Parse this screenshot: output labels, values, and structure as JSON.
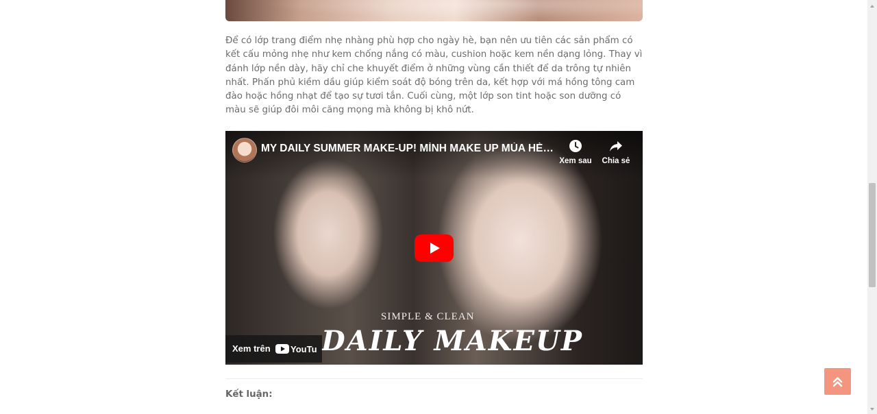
{
  "article": {
    "paragraph": "Để có lớp trang điểm nhẹ nhàng phù hợp cho ngày hè, bạn nên ưu tiên các sản phẩm có kết cấu mỏng nhẹ như kem chống nắng có màu, cushion hoặc kem nền dạng lỏng. Thay vì đánh lớp nền dày, hãy chỉ che khuyết điểm ở những vùng cần thiết để da trông tự nhiên nhất. Phấn phủ kiềm dầu giúp kiểm soát độ bóng trên da, kết hợp với má hồng tông cam đào hoặc hồng nhạt để tạo sự tươi tắn. Cuối cùng, một lớp son tint hoặc son dưỡng có màu sẽ giúp đôi môi căng mọng mà không bị khô nứt.",
    "conclusion_heading": "Kết luận:"
  },
  "video": {
    "title": "MY DAILY SUMMER MAKE-UP! MÌNH MAKE UP MÙA HÈ NHƯ ...",
    "watch_later_label": "Xem sau",
    "share_label": "Chia sẻ",
    "watch_on_label": "Xem trên",
    "youtube_logo_text": "YouTube",
    "overlay_small": "SIMPLE & CLEAN",
    "overlay_big": "DAILY MAKEUP",
    "play_icon": "youtube-play-icon"
  },
  "colors": {
    "back_to_top_bg": "#f4967f",
    "play_red": "#ff0000",
    "text_gray": "#6b6b6b"
  }
}
